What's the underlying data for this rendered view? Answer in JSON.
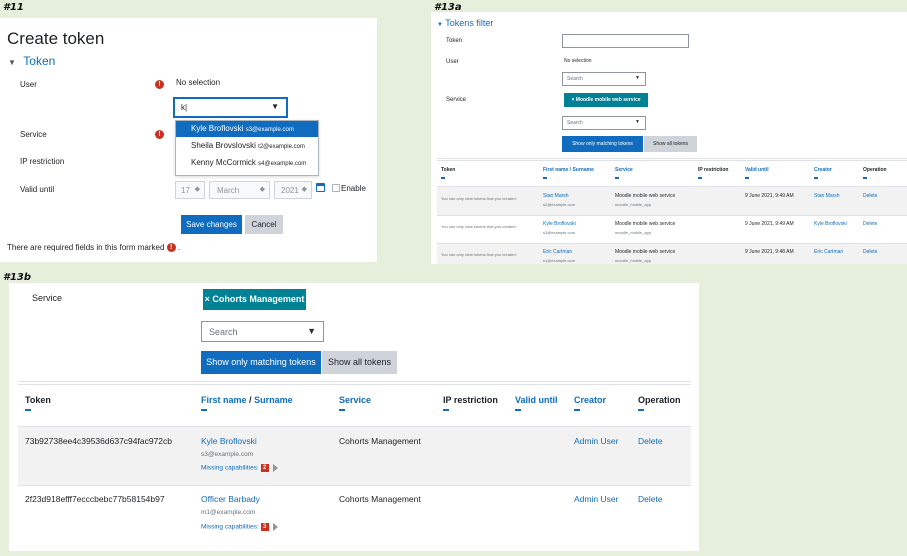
{
  "labels": {
    "a": "#11",
    "b": "#13a",
    "c": "#13b"
  },
  "panel11": {
    "title": "Create token",
    "section": "Token",
    "fields": {
      "user_label": "User",
      "user_value": "No selection",
      "search_value": "k|",
      "service_label": "Service",
      "ip_label": "IP restriction",
      "valid_label": "Valid until",
      "day": "17",
      "month": "March",
      "year": "2021",
      "enable_label": "Enable"
    },
    "dropdown": [
      {
        "name": "Kyle Broflovski",
        "email": "s3@example.com"
      },
      {
        "name": "Sheila Brovslovski",
        "email": "t2@example.com"
      },
      {
        "name": "Kenny McCormick",
        "email": "s4@example.com"
      }
    ],
    "save_label": "Save changes",
    "cancel_label": "Cancel",
    "required_note": "There are required fields in this form marked",
    "required_suffix": "."
  },
  "panel13a": {
    "section": "Tokens filter",
    "token_label": "Token",
    "user_label": "User",
    "user_value": "No selection",
    "search_placeholder": "Search",
    "service_label": "Service",
    "service_pill": "× Moodle mobile web service",
    "show_matching": "Show only matching tokens",
    "show_all": "Show all tokens",
    "headers": {
      "token": "Token",
      "first_name": "First name",
      "surname": "Surname",
      "service": "Service",
      "ip": "IP restriction",
      "valid": "Valid until",
      "creator": "Creator",
      "operation": "Operation"
    },
    "rows": [
      {
        "token": "You can only view tokens that you created.",
        "name": "Stan Marsh",
        "email": "s2@example.com",
        "service": "Moodle mobile web service",
        "service_short": "moodle_mobile_app",
        "valid": "9 June 2021, 9:49 AM",
        "creator": "Stan Marsh",
        "op": "Delete"
      },
      {
        "token": "You can only view tokens that you created.",
        "name": "Kyle Broflovski",
        "email": "s3@example.com",
        "service": "Moodle mobile web service",
        "service_short": "moodle_mobile_app",
        "valid": "9 June 2021, 9:49 AM",
        "creator": "Kyle Broflovski",
        "op": "Delete"
      },
      {
        "token": "You can only view tokens that you created.",
        "name": "Eric Cartman",
        "email": "s1@example.com",
        "service": "Moodle mobile web service",
        "service_short": "moodle_mobile_app",
        "valid": "9 June 2021, 9:48 AM",
        "creator": "Eric Cartman",
        "op": "Delete"
      }
    ]
  },
  "panel13b": {
    "service_label": "Service",
    "service_pill": "× Cohorts Management",
    "search_placeholder": "Search",
    "show_matching": "Show only matching tokens",
    "show_all": "Show all tokens",
    "headers": {
      "token": "Token",
      "first_name": "First name",
      "surname": "Surname",
      "service": "Service",
      "ip": "IP restriction",
      "valid": "Valid until",
      "creator": "Creator",
      "operation": "Operation"
    },
    "missing_label": "Missing capabilities:",
    "rows": [
      {
        "token": "73b92738ee4c39536d637c94fac972cb",
        "name": "Kyle Broflovski",
        "email": "s3@example.com",
        "service": "Cohorts Management",
        "creator": "Admin User",
        "op": "Delete",
        "missing_count": "2"
      },
      {
        "token": "2f23d918efff7ecccbebc77b58154b97",
        "name": "Officer Barbady",
        "email": "m1@example.com",
        "service": "Cohorts Management",
        "creator": "Admin User",
        "op": "Delete",
        "missing_count": "3"
      }
    ]
  }
}
